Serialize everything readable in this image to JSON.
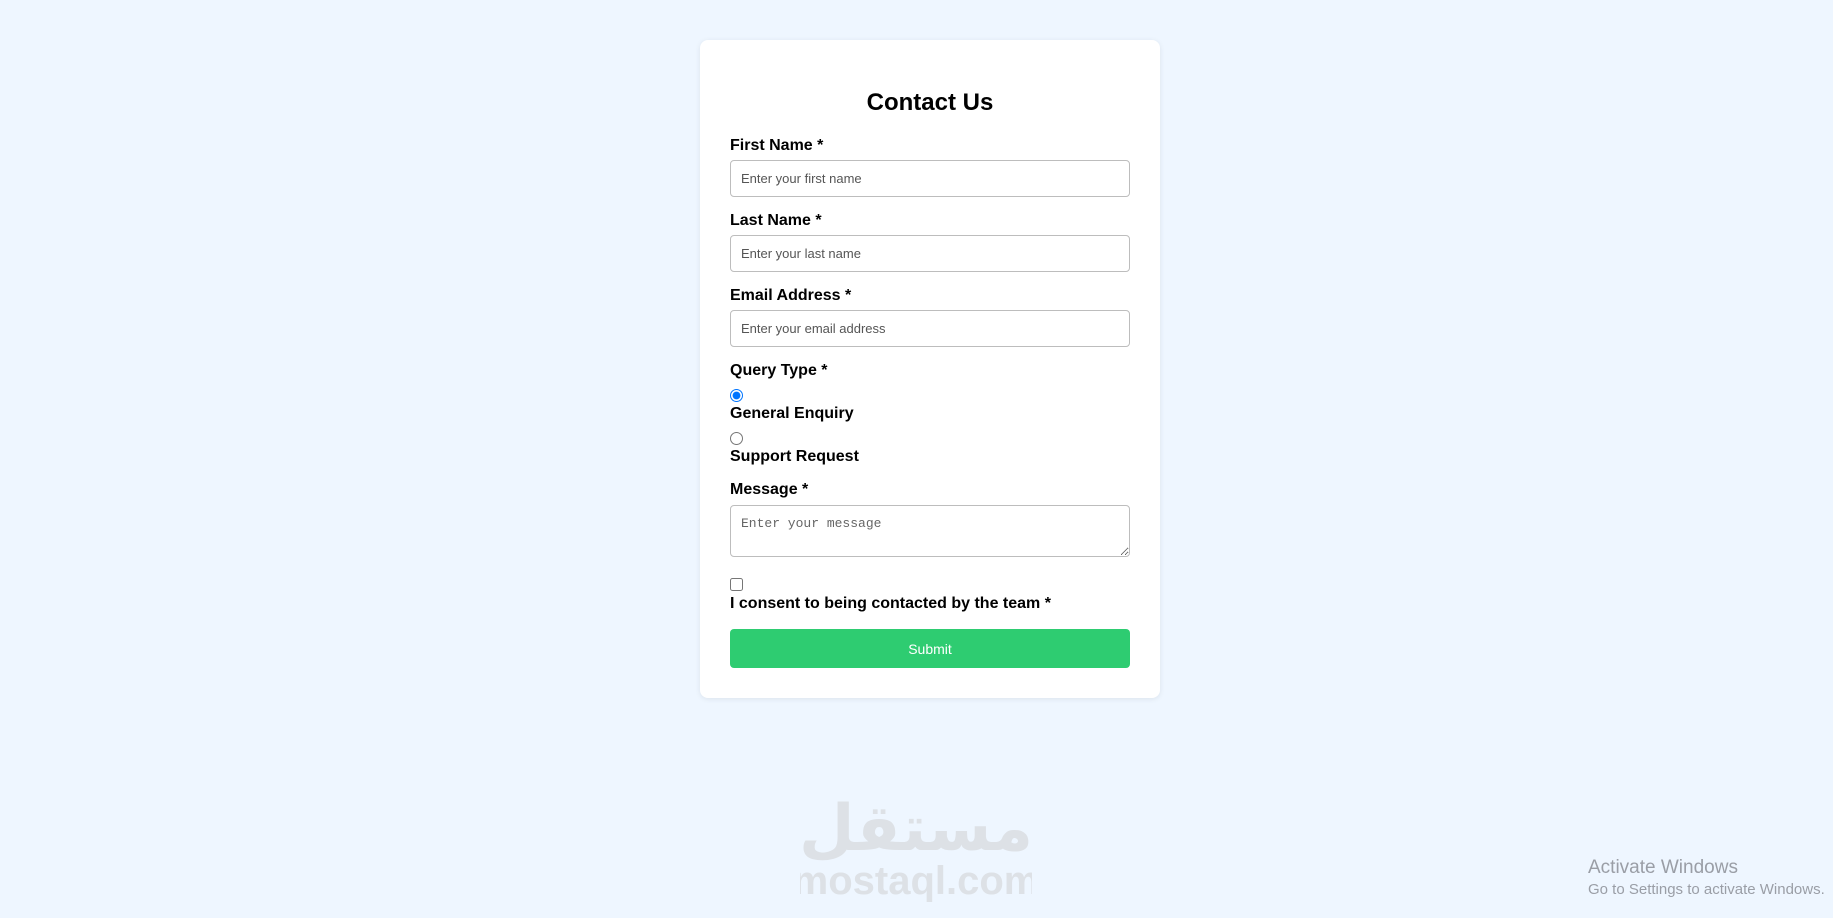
{
  "form": {
    "title": "Contact Us",
    "first_name": {
      "label": "First Name *",
      "placeholder": "Enter your first name",
      "value": ""
    },
    "last_name": {
      "label": "Last Name *",
      "placeholder": "Enter your last name",
      "value": ""
    },
    "email": {
      "label": "Email Address *",
      "placeholder": "Enter your email address",
      "value": ""
    },
    "query_type": {
      "label": "Query  Type *",
      "options": [
        {
          "label": "General Enquiry",
          "checked": true
        },
        {
          "label": "Support Request",
          "checked": false
        }
      ]
    },
    "message": {
      "label": "Message *",
      "placeholder": "Enter your message",
      "value": ""
    },
    "consent": {
      "label": "I consent to being contacted by the team *",
      "checked": false
    },
    "submit_label": "Submit"
  },
  "watermark": {
    "logo_text": "مستقل",
    "domain_text": "mostaql.com",
    "color": "#dde1e6"
  },
  "os_notice": {
    "line1": "Activate Windows",
    "line2": "Go to Settings to activate Windows."
  },
  "colors": {
    "background": "#eef6ff",
    "card": "#ffffff",
    "submit": "#2ecc71"
  }
}
